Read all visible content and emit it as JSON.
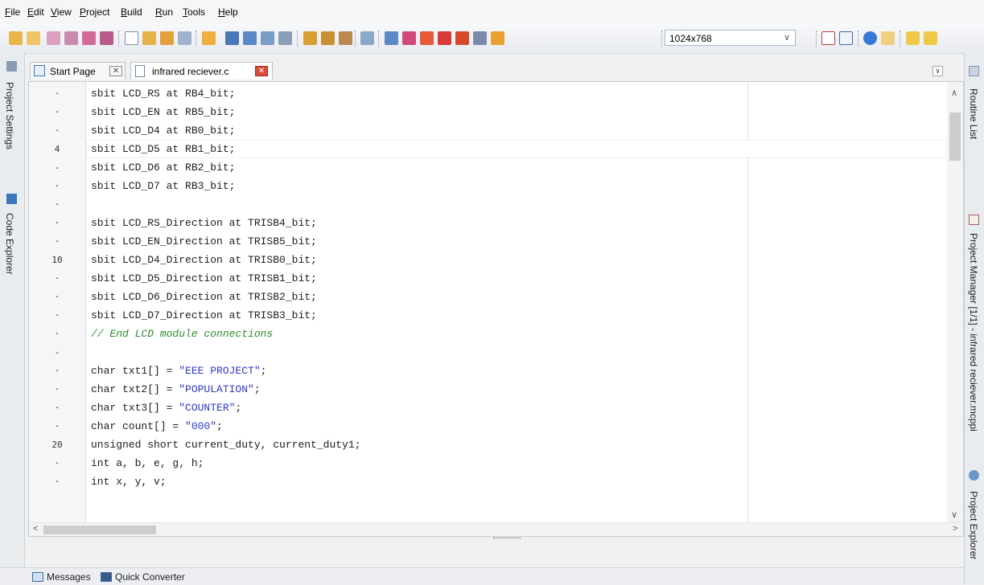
{
  "menu": [
    "File",
    "Edit",
    "View",
    "Project",
    "Build",
    "Run",
    "Tools",
    "Help"
  ],
  "menu_access_keys": [
    "F",
    "E",
    "V",
    "P",
    "B",
    "R",
    "T",
    "H"
  ],
  "toolbar": {
    "resolution": "1024x768"
  },
  "left_panels": [
    "Project Settings",
    "Code Explorer"
  ],
  "right_panels": [
    "Routine List",
    "Project Manager [1/1] - infrared reciever.mcppi",
    "Project Explorer"
  ],
  "tabs": [
    {
      "label": "Start Page",
      "active": false
    },
    {
      "label": "infrared reciever.c",
      "active": true
    }
  ],
  "editor": {
    "lines": [
      {
        "num": "·",
        "code": "sbit LCD_RS at RB4_bit;"
      },
      {
        "num": "·",
        "code": "sbit LCD_EN at RB5_bit;"
      },
      {
        "num": "·",
        "code": "sbit LCD_D4 at RB0_bit;"
      },
      {
        "num": "4",
        "code": "sbit LCD_D5 at RB1_bit;"
      },
      {
        "num": "-",
        "code": "sbit LCD_D6 at RB2_bit;"
      },
      {
        "num": "·",
        "code": "sbit LCD_D7 at RB3_bit;"
      },
      {
        "num": "·",
        "code": ""
      },
      {
        "num": "·",
        "code": "sbit LCD_RS_Direction at TRISB4_bit;"
      },
      {
        "num": "·",
        "code": "sbit LCD_EN_Direction at TRISB5_bit;"
      },
      {
        "num": "10",
        "code": "sbit LCD_D4_Direction at TRISB0_bit;"
      },
      {
        "num": "·",
        "code": "sbit LCD_D5_Direction at TRISB1_bit;"
      },
      {
        "num": "·",
        "code": "sbit LCD_D6_Direction at TRISB2_bit;"
      },
      {
        "num": "·",
        "code": "sbit LCD_D7_Direction at TRISB3_bit;"
      },
      {
        "num": "·",
        "code": "// End LCD module connections"
      },
      {
        "num": "-",
        "code": ""
      },
      {
        "num": "·",
        "code": "char txt1[] = \"EEE PROJECT\";"
      },
      {
        "num": "·",
        "code": "char txt2[] = \"POPULATION\";"
      },
      {
        "num": "·",
        "code": "char txt3[] = \"COUNTER\";"
      },
      {
        "num": "·",
        "code": "char count[] = \"000\";"
      },
      {
        "num": "20",
        "code": "unsigned short current_duty, current_duty1;"
      },
      {
        "num": "·",
        "code": "int a, b, e, g, h;"
      },
      {
        "num": "·",
        "code": "int x, y, v;"
      }
    ],
    "current_line_index": 3
  },
  "bottom_tabs": [
    "Messages",
    "Quick Converter"
  ],
  "colors": {
    "string": "#2e37c9",
    "comment": "#2e8b2e",
    "keyword": "#000000"
  }
}
